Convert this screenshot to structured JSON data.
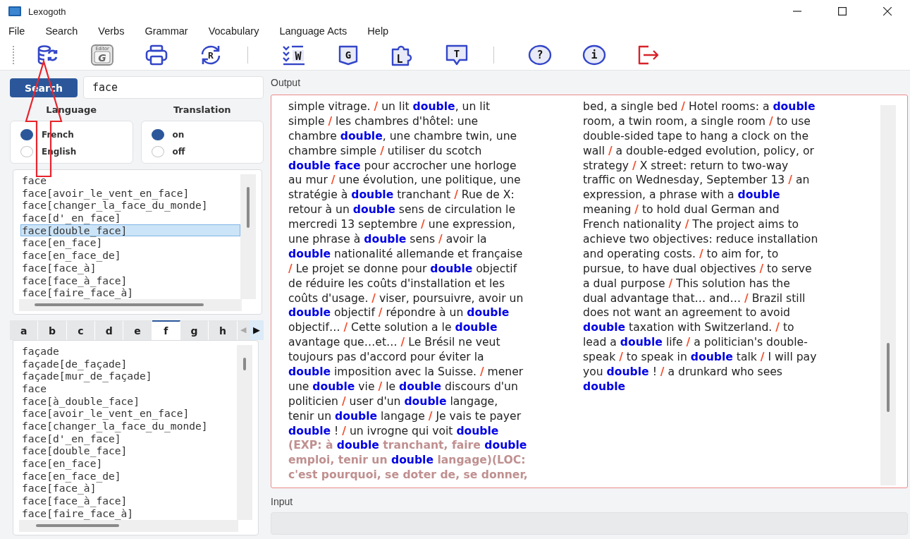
{
  "window": {
    "title": "Lexogoth"
  },
  "menu": [
    "File",
    "Search",
    "Verbs",
    "Grammar",
    "Vocabulary",
    "Language Acts",
    "Help"
  ],
  "toolbar": [
    [
      {
        "kind": "database"
      },
      {
        "kind": "editor",
        "caption": "Editor",
        "glyph": "G"
      },
      {
        "kind": "printer"
      },
      {
        "kind": "refresh",
        "glyph": "R"
      }
    ],
    [
      {
        "kind": "checklist",
        "glyph": "W"
      },
      {
        "kind": "book",
        "glyph": "G"
      },
      {
        "kind": "puzzle",
        "glyph": "L"
      },
      {
        "kind": "speech",
        "glyph": "T"
      }
    ],
    [
      {
        "kind": "help",
        "glyph": "?"
      },
      {
        "kind": "info",
        "glyph": "i"
      },
      {
        "kind": "exit"
      }
    ]
  ],
  "search": {
    "button": "Search",
    "value": "face"
  },
  "language": {
    "title": "Language",
    "options": [
      {
        "label": "French",
        "selected": true
      },
      {
        "label": "English",
        "selected": false
      }
    ]
  },
  "translation": {
    "title": "Translation",
    "options": [
      {
        "label": "on",
        "selected": true
      },
      {
        "label": "off",
        "selected": false
      }
    ]
  },
  "results": [
    {
      "text": "face",
      "selected": false
    },
    {
      "text": "face[avoir_le_vent_en_face]",
      "selected": false
    },
    {
      "text": "face[changer_la_face_du_monde]",
      "selected": false
    },
    {
      "text": "face[d'_en_face]",
      "selected": false
    },
    {
      "text": "face[double_face]",
      "selected": true
    },
    {
      "text": "face[en_face]",
      "selected": false
    },
    {
      "text": "face[en_face_de]",
      "selected": false
    },
    {
      "text": "face[face_à]",
      "selected": false
    },
    {
      "text": "face[face_à_face]",
      "selected": false
    },
    {
      "text": "face[faire_face_à]",
      "selected": false
    }
  ],
  "alphabet_tabs": [
    {
      "label": "a",
      "selected": false
    },
    {
      "label": "b",
      "selected": false
    },
    {
      "label": "c",
      "selected": false
    },
    {
      "label": "d",
      "selected": false
    },
    {
      "label": "e",
      "selected": false
    },
    {
      "label": "f",
      "selected": true
    },
    {
      "label": "g",
      "selected": false
    },
    {
      "label": "h",
      "selected": false
    }
  ],
  "tab_scroll": [
    {
      "glyph": "◀",
      "disabled": true
    },
    {
      "glyph": "▶",
      "disabled": false
    }
  ],
  "index_list": [
    "façade",
    "façade[de_façade]",
    "façade[mur_de_façade]",
    "face",
    "face[à_double_face]",
    "face[avoir_le_vent_en_face]",
    "face[changer_la_face_du_monde]",
    "face[d'_en_face]",
    "face[double_face]",
    "face[en_face]",
    "face[en_face_de]",
    "face[face_à]",
    "face[face_à_face]",
    "face[faire_face_à]"
  ],
  "output": {
    "label": "Output",
    "columns": [
      [
        [
          {
            "kind": "plain",
            "text": "simple vitrage. "
          },
          {
            "kind": "sep",
            "text": "/"
          },
          {
            "kind": "plain",
            "text": " un lit "
          },
          {
            "kind": "term",
            "text": "double"
          },
          {
            "kind": "plain",
            "text": ", un lit"
          }
        ],
        [
          {
            "kind": "plain",
            "text": "simple "
          },
          {
            "kind": "sep",
            "text": "/"
          },
          {
            "kind": "plain",
            "text": " les chambres d'hôtel: une"
          }
        ],
        [
          {
            "kind": "plain",
            "text": "chambre "
          },
          {
            "kind": "term",
            "text": "double"
          },
          {
            "kind": "plain",
            "text": ", une chambre twin, une"
          }
        ],
        [
          {
            "kind": "plain",
            "text": "chambre simple "
          },
          {
            "kind": "sep",
            "text": "/"
          },
          {
            "kind": "plain",
            "text": " utiliser du scotch"
          }
        ],
        [
          {
            "kind": "term",
            "text": "double face"
          },
          {
            "kind": "plain",
            "text": " pour accrocher une horloge"
          }
        ],
        [
          {
            "kind": "plain",
            "text": "au mur "
          },
          {
            "kind": "sep",
            "text": "/"
          },
          {
            "kind": "plain",
            "text": " une évolution, une politique, une"
          }
        ],
        [
          {
            "kind": "plain",
            "text": "stratégie à "
          },
          {
            "kind": "term",
            "text": "double"
          },
          {
            "kind": "plain",
            "text": " tranchant "
          },
          {
            "kind": "sep",
            "text": "/"
          },
          {
            "kind": "plain",
            "text": " Rue de X:"
          }
        ],
        [
          {
            "kind": "plain",
            "text": "retour à un "
          },
          {
            "kind": "term",
            "text": "double"
          },
          {
            "kind": "plain",
            "text": " sens de circulation le"
          }
        ],
        [
          {
            "kind": "plain",
            "text": "mercredi 13 septembre "
          },
          {
            "kind": "sep",
            "text": "/"
          },
          {
            "kind": "plain",
            "text": " une expression,"
          }
        ],
        [
          {
            "kind": "plain",
            "text": "une phrase à "
          },
          {
            "kind": "term",
            "text": "double"
          },
          {
            "kind": "plain",
            "text": " sens "
          },
          {
            "kind": "sep",
            "text": "/"
          },
          {
            "kind": "plain",
            "text": " avoir la"
          }
        ],
        [
          {
            "kind": "term",
            "text": "double"
          },
          {
            "kind": "plain",
            "text": " nationalité allemande et française"
          }
        ],
        [
          {
            "kind": "sep",
            "text": "/"
          },
          {
            "kind": "plain",
            "text": " Le projet se donne pour "
          },
          {
            "kind": "term",
            "text": "double"
          },
          {
            "kind": "plain",
            "text": " objectif"
          }
        ],
        [
          {
            "kind": "plain",
            "text": "de réduire les coûts d'installation et les"
          }
        ],
        [
          {
            "kind": "plain",
            "text": "coûts d'usage. "
          },
          {
            "kind": "sep",
            "text": "/"
          },
          {
            "kind": "plain",
            "text": " viser, poursuivre, avoir un"
          }
        ],
        [
          {
            "kind": "term",
            "text": "double"
          },
          {
            "kind": "plain",
            "text": " objectif "
          },
          {
            "kind": "sep",
            "text": "/"
          },
          {
            "kind": "plain",
            "text": " répondre à un "
          },
          {
            "kind": "term",
            "text": "double"
          }
        ],
        [
          {
            "kind": "plain",
            "text": "objectif… "
          },
          {
            "kind": "sep",
            "text": "/"
          },
          {
            "kind": "plain",
            "text": " Cette solution a le "
          },
          {
            "kind": "term",
            "text": "double"
          }
        ],
        [
          {
            "kind": "plain",
            "text": "avantage que…et… "
          },
          {
            "kind": "sep",
            "text": "/"
          },
          {
            "kind": "plain",
            "text": " Le Brésil ne veut"
          }
        ],
        [
          {
            "kind": "plain",
            "text": "toujours pas d'accord pour éviter la"
          }
        ],
        [
          {
            "kind": "term",
            "text": "double"
          },
          {
            "kind": "plain",
            "text": " imposition avec la Suisse. "
          },
          {
            "kind": "sep",
            "text": "/"
          },
          {
            "kind": "plain",
            "text": " mener"
          }
        ],
        [
          {
            "kind": "plain",
            "text": "une "
          },
          {
            "kind": "term",
            "text": "double"
          },
          {
            "kind": "plain",
            "text": " vie "
          },
          {
            "kind": "sep",
            "text": "/"
          },
          {
            "kind": "plain",
            "text": " le "
          },
          {
            "kind": "term",
            "text": "double"
          },
          {
            "kind": "plain",
            "text": " discours d'un"
          }
        ],
        [
          {
            "kind": "plain",
            "text": "politicien "
          },
          {
            "kind": "sep",
            "text": "/"
          },
          {
            "kind": "plain",
            "text": " user d'un "
          },
          {
            "kind": "term",
            "text": "double"
          },
          {
            "kind": "plain",
            "text": " langage,"
          }
        ],
        [
          {
            "kind": "plain",
            "text": "tenir un "
          },
          {
            "kind": "term",
            "text": "double"
          },
          {
            "kind": "plain",
            "text": " langage "
          },
          {
            "kind": "sep",
            "text": "/"
          },
          {
            "kind": "plain",
            "text": " Je vais te payer"
          }
        ],
        [
          {
            "kind": "term",
            "text": "double"
          },
          {
            "kind": "plain",
            "text": " ! "
          },
          {
            "kind": "sep",
            "text": "/"
          },
          {
            "kind": "plain",
            "text": " un ivrogne qui voit "
          },
          {
            "kind": "term",
            "text": "double"
          }
        ],
        [
          {
            "kind": "note",
            "text": "(EXP: à "
          },
          {
            "kind": "term",
            "text": "double"
          },
          {
            "kind": "note",
            "text": " tranchant, faire "
          },
          {
            "kind": "term",
            "text": "double"
          }
        ],
        [
          {
            "kind": "note",
            "text": "emploi, tenir un "
          },
          {
            "kind": "term",
            "text": "double"
          },
          {
            "kind": "note",
            "text": " langage)(LOC:"
          }
        ],
        [
          {
            "kind": "note",
            "text": "c'est pourquoi, se doter de, se donner,"
          }
        ]
      ],
      [
        [
          {
            "kind": "plain",
            "text": "bed, a single bed "
          },
          {
            "kind": "sep",
            "text": "/"
          },
          {
            "kind": "plain",
            "text": " Hotel rooms: a "
          },
          {
            "kind": "term",
            "text": "double"
          }
        ],
        [
          {
            "kind": "plain",
            "text": "room, a twin room, a single room "
          },
          {
            "kind": "sep",
            "text": "/"
          },
          {
            "kind": "plain",
            "text": " to use"
          }
        ],
        [
          {
            "kind": "plain",
            "text": "double-sided tape to hang a clock on the"
          }
        ],
        [
          {
            "kind": "plain",
            "text": "wall "
          },
          {
            "kind": "sep",
            "text": "/"
          },
          {
            "kind": "plain",
            "text": " a double-edged evolution, policy, or"
          }
        ],
        [
          {
            "kind": "plain",
            "text": "strategy "
          },
          {
            "kind": "sep",
            "text": "/"
          },
          {
            "kind": "plain",
            "text": " X street: return to two-way"
          }
        ],
        [
          {
            "kind": "plain",
            "text": "traffic on Wednesday, September 13 "
          },
          {
            "kind": "sep",
            "text": "/"
          },
          {
            "kind": "plain",
            "text": " an"
          }
        ],
        [
          {
            "kind": "plain",
            "text": "expression, a phrase with a "
          },
          {
            "kind": "term",
            "text": "double"
          }
        ],
        [
          {
            "kind": "plain",
            "text": "meaning "
          },
          {
            "kind": "sep",
            "text": "/"
          },
          {
            "kind": "plain",
            "text": " to hold dual German and"
          }
        ],
        [
          {
            "kind": "plain",
            "text": "French nationality "
          },
          {
            "kind": "sep",
            "text": "/"
          },
          {
            "kind": "plain",
            "text": " The project aims to"
          }
        ],
        [
          {
            "kind": "plain",
            "text": "achieve two objectives: reduce installation"
          }
        ],
        [
          {
            "kind": "plain",
            "text": "and operating costs. "
          },
          {
            "kind": "sep",
            "text": "/"
          },
          {
            "kind": "plain",
            "text": " to aim for, to"
          }
        ],
        [
          {
            "kind": "plain",
            "text": "pursue, to have dual objectives "
          },
          {
            "kind": "sep",
            "text": "/"
          },
          {
            "kind": "plain",
            "text": " to serve"
          }
        ],
        [
          {
            "kind": "plain",
            "text": "a dual purpose "
          },
          {
            "kind": "sep",
            "text": "/"
          },
          {
            "kind": "plain",
            "text": " This solution has the"
          }
        ],
        [
          {
            "kind": "plain",
            "text": "dual advantage that… and… "
          },
          {
            "kind": "sep",
            "text": "/"
          },
          {
            "kind": "plain",
            "text": " Brazil still"
          }
        ],
        [
          {
            "kind": "plain",
            "text": "does not want an agreement to avoid"
          }
        ],
        [
          {
            "kind": "term",
            "text": "double"
          },
          {
            "kind": "plain",
            "text": " taxation with Switzerland. "
          },
          {
            "kind": "sep",
            "text": "/"
          },
          {
            "kind": "plain",
            "text": " to"
          }
        ],
        [
          {
            "kind": "plain",
            "text": "lead a "
          },
          {
            "kind": "term",
            "text": "double"
          },
          {
            "kind": "plain",
            "text": " life "
          },
          {
            "kind": "sep",
            "text": "/"
          },
          {
            "kind": "plain",
            "text": " a politician's double-"
          }
        ],
        [
          {
            "kind": "plain",
            "text": "speak "
          },
          {
            "kind": "sep",
            "text": "/"
          },
          {
            "kind": "plain",
            "text": " to speak in "
          },
          {
            "kind": "term",
            "text": "double"
          },
          {
            "kind": "plain",
            "text": " talk "
          },
          {
            "kind": "sep",
            "text": "/"
          },
          {
            "kind": "plain",
            "text": " I will pay"
          }
        ],
        [
          {
            "kind": "plain",
            "text": "you "
          },
          {
            "kind": "term",
            "text": "double"
          },
          {
            "kind": "plain",
            "text": " ! "
          },
          {
            "kind": "sep",
            "text": "/"
          },
          {
            "kind": "plain",
            "text": " a drunkard who sees"
          }
        ],
        [
          {
            "kind": "term",
            "text": "double"
          }
        ]
      ]
    ]
  },
  "input": {
    "label": "Input"
  }
}
